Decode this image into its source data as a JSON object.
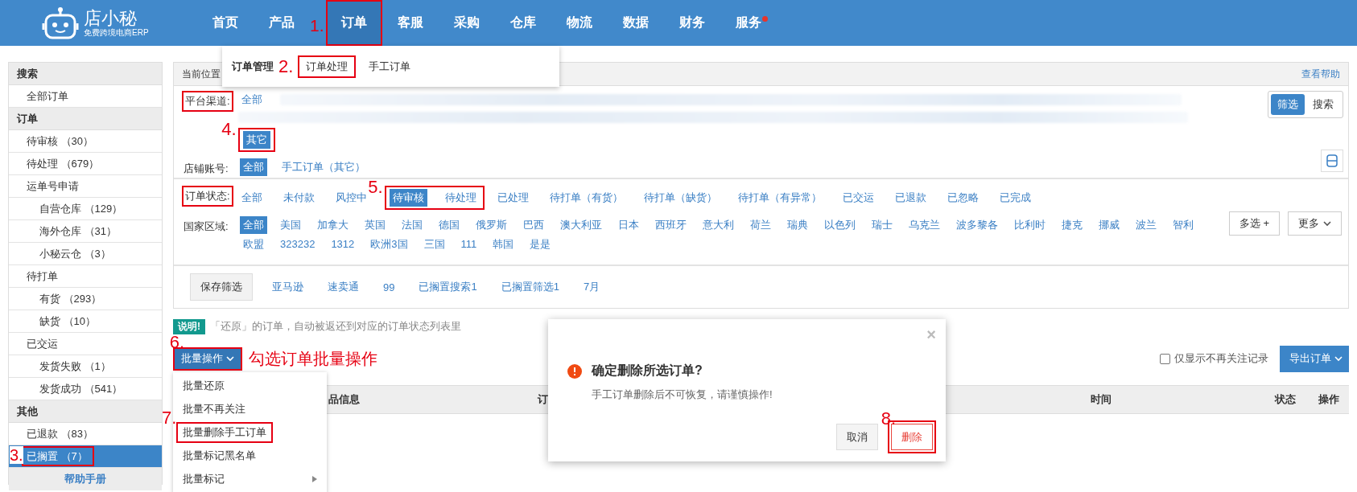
{
  "logo": {
    "name": "店小秘",
    "tagline": "免费跨境电商ERP"
  },
  "nav": {
    "items": [
      {
        "label": "首页",
        "selected": false
      },
      {
        "label": "产品",
        "selected": false
      },
      {
        "label": "订单",
        "selected": true,
        "highlighted": true,
        "step": "1."
      },
      {
        "label": "客服",
        "selected": false
      },
      {
        "label": "采购",
        "selected": false
      },
      {
        "label": "仓库",
        "selected": false
      },
      {
        "label": "物流",
        "selected": false
      },
      {
        "label": "数据",
        "selected": false
      },
      {
        "label": "财务",
        "selected": false
      },
      {
        "label": "服务",
        "selected": false,
        "dot": true
      }
    ]
  },
  "nav_menu": {
    "title": "订单管理",
    "step": "2.",
    "items": [
      {
        "label": "订单处理",
        "highlighted": true
      },
      {
        "label": "手工订单"
      }
    ]
  },
  "sidebar": {
    "sections": [
      {
        "title": "搜索",
        "items": [
          {
            "label": "全部订单",
            "selected": false
          }
        ]
      },
      {
        "title": "订单",
        "items": [
          {
            "label": "待审核 （30）",
            "selected": false
          },
          {
            "label": "待处理 （679）",
            "selected": false
          },
          {
            "label": "运单号申请",
            "selected": false,
            "children": [
              {
                "label": "自营仓库 （129）",
                "selected": false
              },
              {
                "label": "海外仓库 （31）",
                "selected": false
              },
              {
                "label": "小秘云仓 （3）",
                "selected": false
              }
            ]
          },
          {
            "label": "待打单",
            "selected": false,
            "children": [
              {
                "label": "有货 （293）",
                "selected": false
              },
              {
                "label": "缺货 （10）",
                "selected": false
              }
            ]
          },
          {
            "label": "已交运",
            "selected": false,
            "children": [
              {
                "label": "发货失败 （1）",
                "selected": false
              },
              {
                "label": "发货成功 （541）",
                "selected": false
              }
            ]
          }
        ]
      },
      {
        "title": "其他",
        "items": [
          {
            "label": "已退款 （83）",
            "selected": false
          },
          {
            "label": "已搁置 （7）",
            "selected": true,
            "highlighted": true,
            "step": "3."
          }
        ]
      }
    ],
    "help_link": "帮助手册"
  },
  "breadcrumb": {
    "label": "当前位置",
    "help": "查看帮助"
  },
  "view_toggle": [
    {
      "label": "筛选",
      "selected": true
    },
    {
      "label": "搜索",
      "selected": false
    }
  ],
  "filters": {
    "platform": {
      "label": "平台渠道:",
      "highlighted": true,
      "options": [
        {
          "label": "全部",
          "selected": false
        },
        {
          "label": "其它",
          "selected": true,
          "highlighted": true,
          "step": "4."
        }
      ]
    },
    "store": {
      "label": "店铺账号:",
      "options": [
        {
          "label": "全部",
          "selected": true
        },
        {
          "label": "手工订单（其它）",
          "selected": false
        }
      ]
    },
    "status": {
      "label": "订单状态:",
      "highlighted": true,
      "options": [
        {
          "label": "全部",
          "selected": false
        },
        {
          "label": "未付款",
          "selected": false
        },
        {
          "label": "风控中",
          "selected": false
        },
        {
          "label": "待审核",
          "selected": true,
          "highlighted": true,
          "step": "5."
        },
        {
          "label": "待处理",
          "selected": false,
          "highlighted": true
        },
        {
          "label": "已处理",
          "selected": false
        },
        {
          "label": "待打单（有货）",
          "selected": false
        },
        {
          "label": "待打单（缺货）",
          "selected": false
        },
        {
          "label": "待打单（有异常）",
          "selected": false
        },
        {
          "label": "已交运",
          "selected": false
        },
        {
          "label": "已退款",
          "selected": false
        },
        {
          "label": "已忽略",
          "selected": false
        },
        {
          "label": "已完成",
          "selected": false
        }
      ]
    },
    "country": {
      "label": "国家区域:",
      "options": [
        {
          "label": "全部",
          "selected": true
        },
        {
          "label": "美国",
          "selected": false
        },
        {
          "label": "加拿大",
          "selected": false
        },
        {
          "label": "英国",
          "selected": false
        },
        {
          "label": "法国",
          "selected": false
        },
        {
          "label": "德国",
          "selected": false
        },
        {
          "label": "俄罗斯",
          "selected": false
        },
        {
          "label": "巴西",
          "selected": false
        },
        {
          "label": "澳大利亚",
          "selected": false
        },
        {
          "label": "日本",
          "selected": false
        },
        {
          "label": "西班牙",
          "selected": false
        },
        {
          "label": "意大利",
          "selected": false
        },
        {
          "label": "荷兰",
          "selected": false
        },
        {
          "label": "瑞典",
          "selected": false
        },
        {
          "label": "以色列",
          "selected": false
        },
        {
          "label": "瑞士",
          "selected": false
        },
        {
          "label": "乌克兰",
          "selected": false
        },
        {
          "label": "波多黎各",
          "selected": false
        },
        {
          "label": "比利时",
          "selected": false
        },
        {
          "label": "捷克",
          "selected": false
        },
        {
          "label": "挪威",
          "selected": false
        },
        {
          "label": "波兰",
          "selected": false
        },
        {
          "label": "智利",
          "selected": false
        },
        {
          "label": "欧盟",
          "selected": false
        },
        {
          "label": "323232",
          "selected": false
        },
        {
          "label": "1312",
          "selected": false
        },
        {
          "label": "欧洲3国",
          "selected": false
        },
        {
          "label": "三国",
          "selected": false
        },
        {
          "label": "111",
          "selected": false
        },
        {
          "label": "韩国",
          "selected": false
        },
        {
          "label": "是是",
          "selected": false
        }
      ],
      "multi_button": "多选 +",
      "more_button": "更多"
    }
  },
  "saved_filters": {
    "button": "保存筛选",
    "items": [
      "亚马逊",
      "速卖通",
      "99",
      "已搁置搜索1",
      "已搁置筛选1",
      "7月"
    ]
  },
  "notice": {
    "badge": "说明!",
    "text": "「还原」的订单，自动被返还到对应的订单状态列表里"
  },
  "batch": {
    "button": "批量操作",
    "highlighted": true,
    "step": "6.",
    "note": "勾选订单批量操作",
    "menu": {
      "items": [
        {
          "label": "批量还原"
        },
        {
          "label": "批量不再关注"
        },
        {
          "label": "批量删除手工订单",
          "highlighted": true,
          "step": "7."
        },
        {
          "label": "批量标记黑名单"
        },
        {
          "label": "批量标记",
          "submenu": true
        }
      ]
    }
  },
  "only_unfollowed": {
    "label": "仅显示不再关注记录",
    "checked": false
  },
  "export_button": "导出订单",
  "table": {
    "columns": [
      "品信息",
      "订",
      "时间",
      "状态",
      "操作"
    ]
  },
  "dialog": {
    "title": "确定删除所选订单?",
    "message": "手工订单删除后不可恢复，请谨慎操作!",
    "close": "×",
    "buttons": [
      {
        "label": "取消",
        "kind": "default"
      },
      {
        "label": "删除",
        "kind": "danger",
        "highlighted": true,
        "step": "8."
      }
    ]
  }
}
